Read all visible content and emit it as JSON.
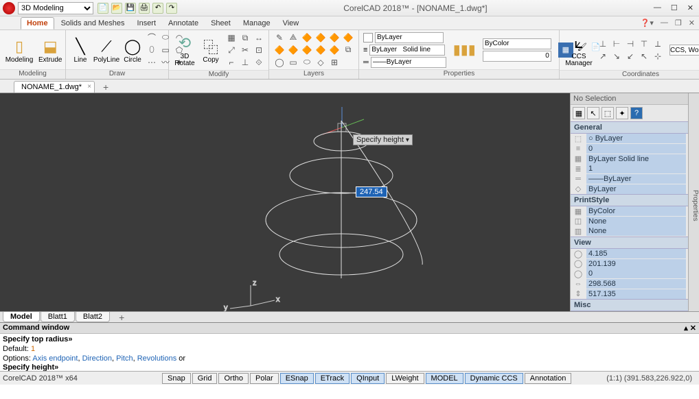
{
  "app": {
    "title": "CorelCAD 2018™ - [NONAME_1.dwg*]",
    "workspace": "3D Modeling"
  },
  "menu": {
    "tabs": [
      "Home",
      "Solids and Meshes",
      "Insert",
      "Annotate",
      "Sheet",
      "Manage",
      "View"
    ],
    "active": "Home"
  },
  "ribbon": {
    "modeling": {
      "label": "Modeling",
      "btn1": "Modeling",
      "btn2": "Extrude"
    },
    "draw": {
      "label": "Draw",
      "btn1": "Line",
      "btn2": "PolyLine",
      "btn3": "Circle"
    },
    "modify": {
      "label": "Modify",
      "btn1": "3D\nRotate",
      "btn2": "Copy"
    },
    "layers": {
      "label": "Layers",
      "color": "ByLayer",
      "linestyle": "ByLayer   Solid line",
      "weight": "——ByLayer"
    },
    "properties": {
      "label": "Properties",
      "bycolor": "ByColor",
      "value": "0"
    },
    "coords": {
      "label": "Coordinates",
      "ccs": "CCS\nManager",
      "world": "CCS, World"
    }
  },
  "doctab": {
    "name": "NONAME_1.dwg*"
  },
  "viewport": {
    "tooltip": "Specify height",
    "value": "247.54"
  },
  "props": {
    "header": "No Selection",
    "general": {
      "title": "General",
      "rows": [
        {
          "icon": "⬚",
          "value": "○ ByLayer"
        },
        {
          "icon": "≡",
          "value": "0"
        },
        {
          "icon": "▦",
          "value": "ByLayer   Solid line"
        },
        {
          "icon": "≣",
          "value": "1"
        },
        {
          "icon": "═",
          "value": "——ByLayer"
        },
        {
          "icon": "◇",
          "value": "ByLayer"
        }
      ]
    },
    "printstyle": {
      "title": "PrintStyle",
      "rows": [
        {
          "icon": "▦",
          "value": "ByColor"
        },
        {
          "icon": "◫",
          "value": "None"
        },
        {
          "icon": "▥",
          "value": "None"
        }
      ]
    },
    "view": {
      "title": "View",
      "rows": [
        {
          "icon": "◯",
          "value": "4.185"
        },
        {
          "icon": "◯",
          "value": "201.139"
        },
        {
          "icon": "◯",
          "value": "0"
        },
        {
          "icon": "⇔",
          "value": "298.568"
        },
        {
          "icon": "⇕",
          "value": "517.135"
        }
      ]
    },
    "misc": {
      "title": "Misc"
    }
  },
  "bottomtabs": {
    "tabs": [
      "Model",
      "Blatt1",
      "Blatt2"
    ],
    "active": "Model"
  },
  "cmd": {
    "title": "Command window",
    "line1": "Specify top radius»",
    "line2a": "Default: ",
    "line2b": "1",
    "line3a": "Options: ",
    "line3b": "Axis endpoint",
    "line3c": "Direction",
    "line3d": "Pitch",
    "line3e": "Revolutions",
    "line3f": " or",
    "line4": "Specify height»"
  },
  "status": {
    "left": "CorelCAD 2018™ x64",
    "btns": [
      "Snap",
      "Grid",
      "Ortho",
      "Polar",
      "ESnap",
      "ETrack",
      "QInput",
      "LWeight",
      "MODEL",
      "Dynamic CCS",
      "Annotation"
    ],
    "active": [
      "ESnap",
      "ETrack",
      "QInput",
      "MODEL",
      "Dynamic CCS"
    ],
    "right": "(1:1)  (391.583,226.922,0)"
  }
}
